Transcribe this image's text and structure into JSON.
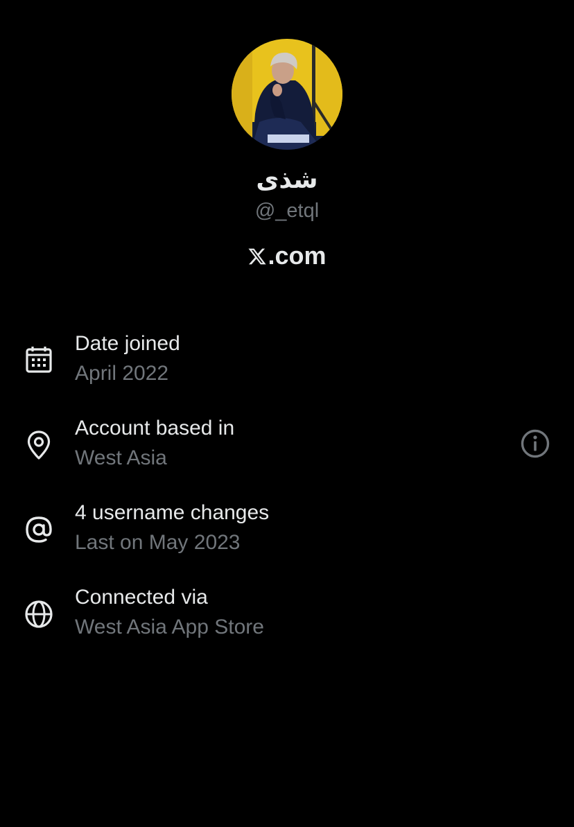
{
  "profile": {
    "display_name": "شذى",
    "handle": "@_etql",
    "site_suffix": ".com",
    "site_icon": "x-logo-icon"
  },
  "details": [
    {
      "icon": "calendar-icon",
      "title": "Date joined",
      "value": "April 2022"
    },
    {
      "icon": "location-pin-icon",
      "title": "Account based in",
      "value": "West Asia",
      "trailing_icon": "info-icon"
    },
    {
      "icon": "at-sign-icon",
      "title": "4 username changes",
      "value": "Last on May 2023"
    },
    {
      "icon": "globe-icon",
      "title": "Connected via",
      "value": "West Asia App Store"
    }
  ],
  "colors": {
    "background": "#000000",
    "primary_text": "#e7e9ea",
    "secondary_text": "#71767b"
  }
}
